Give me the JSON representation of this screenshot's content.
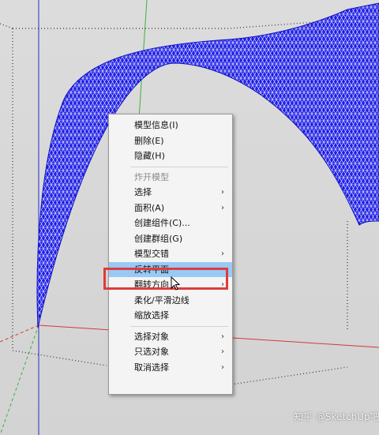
{
  "context_menu": {
    "items": [
      {
        "label": "模型信息(I)",
        "submenu": false,
        "disabled": false,
        "highlighted": false
      },
      {
        "label": "删除(E)",
        "submenu": false,
        "disabled": false,
        "highlighted": false
      },
      {
        "label": "隐藏(H)",
        "submenu": false,
        "disabled": false,
        "highlighted": false
      },
      {
        "separator": true
      },
      {
        "label": "炸开模型",
        "submenu": false,
        "disabled": true,
        "highlighted": false
      },
      {
        "label": "选择",
        "submenu": true,
        "disabled": false,
        "highlighted": false
      },
      {
        "label": "面积(A)",
        "submenu": true,
        "disabled": false,
        "highlighted": false
      },
      {
        "label": "创建组件(C)...",
        "submenu": false,
        "disabled": false,
        "highlighted": false
      },
      {
        "label": "创建群组(G)",
        "submenu": false,
        "disabled": false,
        "highlighted": false
      },
      {
        "label": "模型交错",
        "submenu": true,
        "disabled": false,
        "highlighted": false
      },
      {
        "label": "反转平面",
        "submenu": false,
        "disabled": false,
        "highlighted": true
      },
      {
        "label": "翻转方向",
        "submenu": true,
        "disabled": false,
        "highlighted": false
      },
      {
        "label": "柔化/平滑边线",
        "submenu": false,
        "disabled": false,
        "highlighted": false
      },
      {
        "label": "缩放选择",
        "submenu": false,
        "disabled": false,
        "highlighted": false
      },
      {
        "separator": true
      },
      {
        "label": "选择对象",
        "submenu": true,
        "disabled": false,
        "highlighted": false
      },
      {
        "label": "只选对象",
        "submenu": true,
        "disabled": false,
        "highlighted": false
      },
      {
        "label": "取消选择",
        "submenu": true,
        "disabled": false,
        "highlighted": false
      }
    ]
  },
  "watermark": "知乎 @SketchUp吧",
  "colors": {
    "mesh_fill": "#1f1fe6",
    "mesh_line": "#ffffff",
    "highlight": "#99c9f5",
    "callout_border": "#e03b3b",
    "axis_red": "#d23a3a",
    "axis_green": "#3fb13f",
    "axis_blue": "#2a2ad2"
  }
}
